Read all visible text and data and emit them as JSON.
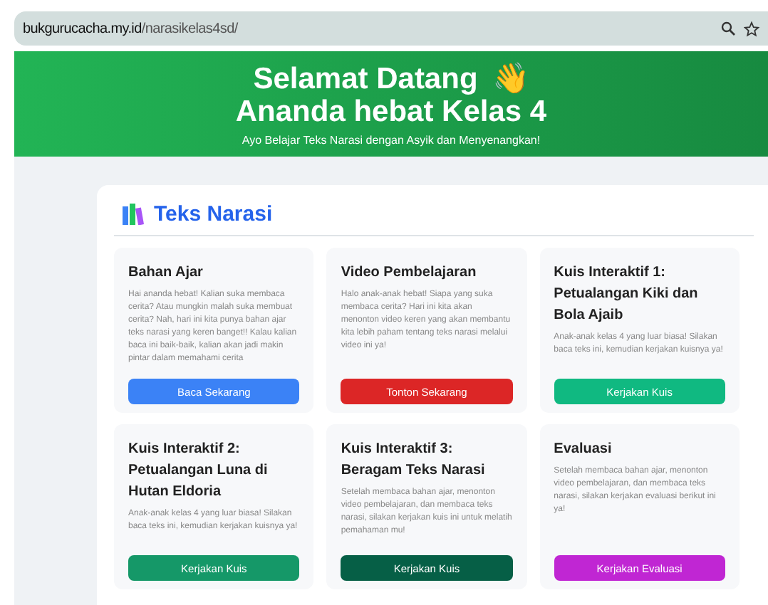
{
  "address_bar": {
    "url_host": "bukgurucacha.my.id",
    "url_path": "/narasikelas4sd/"
  },
  "header": {
    "title_line_1": "Selamat Datang",
    "emoji": "👋",
    "title_line_2": "Ananda hebat Kelas 4",
    "subtitle": "Ayo Belajar Teks Narasi dengan Asyik dan Menyenangkan!"
  },
  "section": {
    "title": "Teks Narasi"
  },
  "cards": [
    {
      "title": "Bahan Ajar",
      "description": "Hai ananda hebat! Kalian suka membaca cerita? Atau mungkin malah suka membuat cerita? Nah, hari ini kita punya bahan ajar teks narasi yang keren banget!! Kalau kalian baca ini baik-baik, kalian akan jadi makin pintar dalam memahami cerita",
      "button": "Baca Sekarang",
      "color": "#3b82f6"
    },
    {
      "title": "Video Pembelajaran",
      "description": "Halo anak-anak hebat! Siapa yang suka membaca cerita? Hari ini kita akan menonton video keren yang akan membantu kita lebih paham tentang teks narasi melalui video ini ya!",
      "button": "Tonton Sekarang",
      "color": "#dc2626"
    },
    {
      "title": "Kuis Interaktif 1: Petualangan Kiki dan Bola Ajaib",
      "description": "Anak-anak kelas 4 yang luar biasa! Silakan baca teks ini, kemudian kerjakan kuisnya ya!",
      "button": "Kerjakan Kuis",
      "color": "#10b981"
    },
    {
      "title": "Kuis Interaktif 2: Petualangan Luna di Hutan Eldoria",
      "description": "Anak-anak kelas 4 yang luar biasa! Silakan baca teks ini, kemudian kerjakan kuisnya ya!",
      "button": "Kerjakan Kuis",
      "color": "#159868"
    },
    {
      "title": "Kuis Interaktif 3: Beragam Teks Narasi",
      "description": "Setelah membaca bahan ajar, menonton video pembelajaran, dan membaca teks narasi, silakan kerjakan kuis ini untuk melatih pemahaman mu!",
      "button": "Kerjakan Kuis",
      "color": "#065f46"
    },
    {
      "title": "Evaluasi",
      "description": "Setelah membaca bahan ajar, menonton video pembelajaran, dan membaca teks narasi, silakan kerjakan evaluasi berikut ini ya!",
      "button": "Kerjakan Evaluasi",
      "color": "#c026d3"
    }
  ]
}
